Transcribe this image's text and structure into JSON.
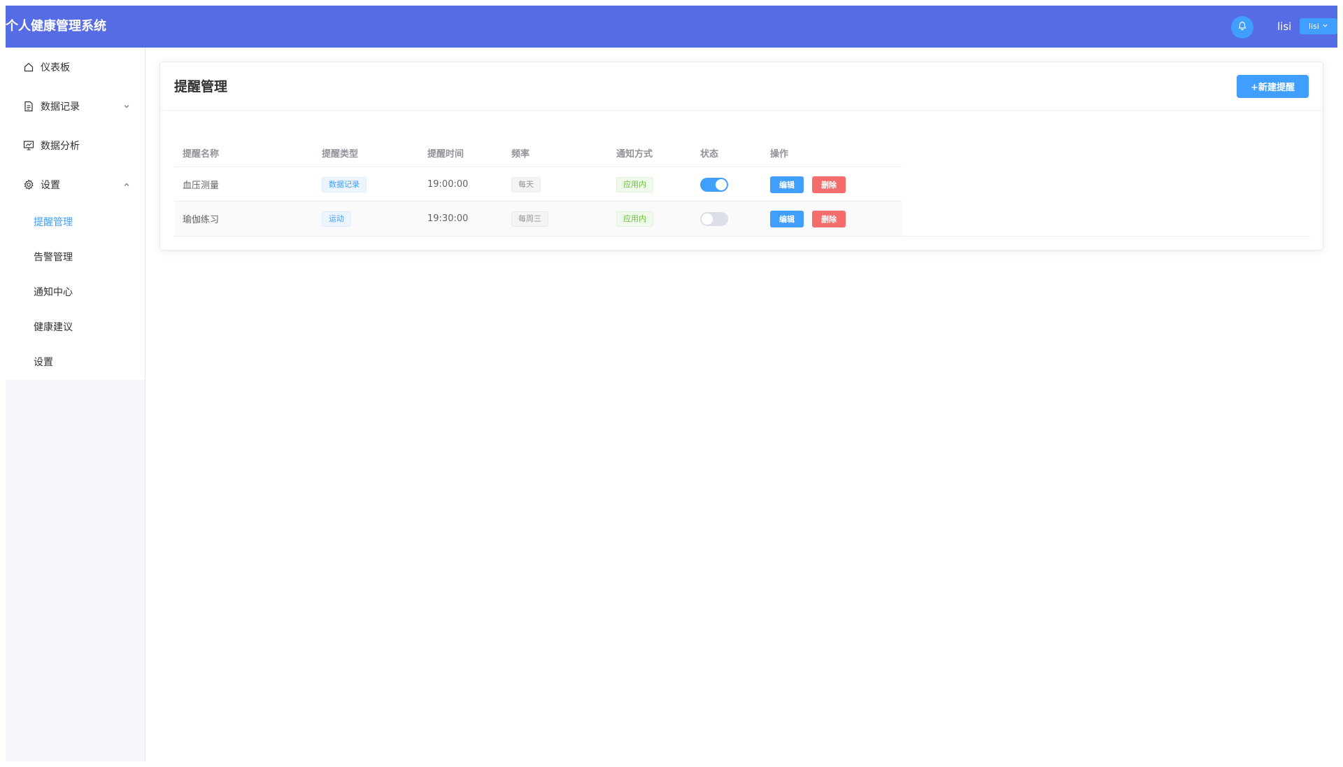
{
  "header": {
    "app_title": "个人健康管理系统",
    "user_name": "lisi",
    "user_dropdown_label": "lisi"
  },
  "sidebar": {
    "items": [
      {
        "label": "仪表板",
        "icon": "home-icon"
      },
      {
        "label": "数据记录",
        "icon": "document-icon",
        "expanded": false
      },
      {
        "label": "数据分析",
        "icon": "chart-board-icon"
      },
      {
        "label": "设置",
        "icon": "gear-icon",
        "expanded": true
      }
    ],
    "sub_items": [
      {
        "label": "提醒管理",
        "active": true
      },
      {
        "label": "告警管理",
        "active": false
      },
      {
        "label": "通知中心",
        "active": false
      },
      {
        "label": "健康建议",
        "active": false
      },
      {
        "label": "设置",
        "active": false
      }
    ]
  },
  "main": {
    "title": "提醒管理",
    "new_button_label": "+新建提醒",
    "table": {
      "columns": [
        "提醒名称",
        "提醒类型",
        "提醒时间",
        "频率",
        "通知方式",
        "状态",
        "操作"
      ],
      "rows": [
        {
          "name": "血压测量",
          "type": "数据记录",
          "time": "19:00:00",
          "frequency": "每天",
          "notify": "应用内",
          "enabled": true,
          "edit": "编辑",
          "delete": "删除"
        },
        {
          "name": "瑜伽练习",
          "type": "运动",
          "time": "19:30:00",
          "frequency": "每周三",
          "notify": "应用内",
          "enabled": false,
          "edit": "编辑",
          "delete": "删除"
        }
      ]
    }
  },
  "colors": {
    "header_bg": "#556ce4",
    "primary": "#409eff",
    "danger": "#f56c6c",
    "success": "#67c23a"
  }
}
